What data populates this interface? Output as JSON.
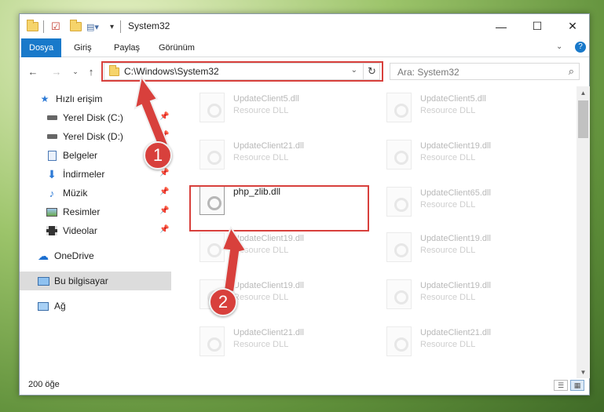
{
  "window": {
    "title": "System32",
    "controls": {
      "minimize": "—",
      "maximize": "☐",
      "close": "✕"
    }
  },
  "ribbon": {
    "tabs": [
      {
        "label": "Dosya",
        "active": true
      },
      {
        "label": "Giriş"
      },
      {
        "label": "Paylaş"
      },
      {
        "label": "Görünüm"
      }
    ]
  },
  "nav": {
    "path": "C:\\Windows\\System32",
    "search_placeholder": "Ara: System32"
  },
  "sidebar": {
    "items": [
      {
        "label": "Hızlı erişim",
        "icon": "star-icon"
      },
      {
        "label": "Yerel Disk (C:)",
        "icon": "drive-icon",
        "pinned": true
      },
      {
        "label": "Yerel Disk (D:)",
        "icon": "drive-icon",
        "pinned": true
      },
      {
        "label": "Belgeler",
        "icon": "documents-icon",
        "pinned": true
      },
      {
        "label": "İndirmeler",
        "icon": "download-icon",
        "pinned": true
      },
      {
        "label": "Müzik",
        "icon": "music-icon",
        "pinned": true
      },
      {
        "label": "Resimler",
        "icon": "pictures-icon",
        "pinned": true
      },
      {
        "label": "Videolar",
        "icon": "videos-icon",
        "pinned": true
      },
      {
        "label": "OneDrive",
        "icon": "cloud-icon"
      },
      {
        "label": "Bu bilgisayar",
        "icon": "computer-icon",
        "selected": true
      },
      {
        "label": "Ağ",
        "icon": "network-icon"
      }
    ]
  },
  "files": [
    {
      "name": "UpdateClient5.dll",
      "desc": "Resource DLL"
    },
    {
      "name": "UpdateClient5.dll",
      "desc": "Resource DLL"
    },
    {
      "name": "UpdateClient21.dll",
      "desc": "Resource DLL"
    },
    {
      "name": "UpdateClient19.dll",
      "desc": "Resource DLL"
    },
    {
      "name": "php_zlib.dll",
      "desc": "",
      "highlight": true
    },
    {
      "name": "UpdateClient65.dll",
      "desc": "Resource DLL"
    },
    {
      "name": "UpdateClient19.dll",
      "desc": "Resource DLL"
    },
    {
      "name": "UpdateClient19.dll",
      "desc": "Resource DLL"
    },
    {
      "name": "UpdateClient19.dll",
      "desc": "Resource DLL"
    },
    {
      "name": "UpdateClient19.dll",
      "desc": "Resource DLL"
    },
    {
      "name": "UpdateClient21.dll",
      "desc": "Resource DLL"
    },
    {
      "name": "UpdateClient21.dll",
      "desc": "Resource DLL"
    }
  ],
  "status": {
    "count": "200 öğe"
  },
  "annotations": {
    "step1": "1",
    "step2": "2",
    "color": "#d8403c"
  }
}
